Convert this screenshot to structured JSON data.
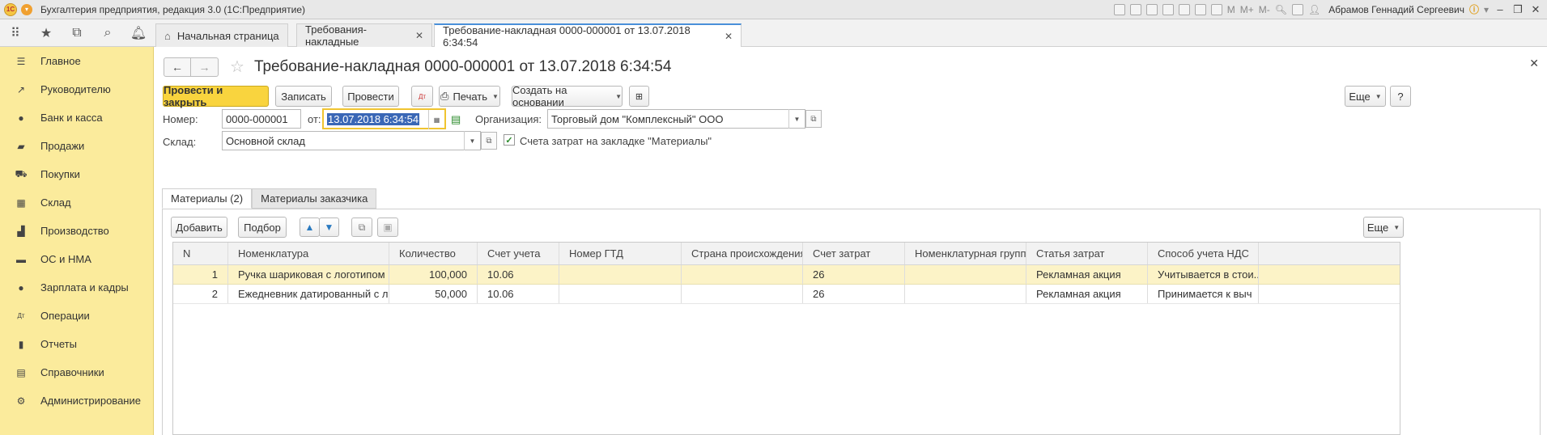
{
  "titlebar": {
    "logo": "1С",
    "app_title": "Бухгалтерия предприятия, редакция 3.0  (1С:Предприятие)",
    "calc_labels": [
      "M",
      "M+",
      "M-"
    ],
    "user": "Абрамов Геннадий Сергеевич"
  },
  "tabs": {
    "home": "Начальная страница",
    "list": "Требования-накладные",
    "doc": "Требование-накладная 0000-000001 от 13.07.2018 6:34:54"
  },
  "sidebar": {
    "items": [
      {
        "label": "Главное",
        "icon": "menu-lines-icon"
      },
      {
        "label": "Руководителю",
        "icon": "trend-icon"
      },
      {
        "label": "Банк и касса",
        "icon": "coin-icon"
      },
      {
        "label": "Продажи",
        "icon": "bag-icon"
      },
      {
        "label": "Покупки",
        "icon": "cart-icon"
      },
      {
        "label": "Склад",
        "icon": "grid-icon"
      },
      {
        "label": "Производство",
        "icon": "factory-icon"
      },
      {
        "label": "ОС и НМА",
        "icon": "truck-icon"
      },
      {
        "label": "Зарплата и кадры",
        "icon": "person-icon"
      },
      {
        "label": "Операции",
        "icon": "dt-kt-icon"
      },
      {
        "label": "Отчеты",
        "icon": "bar-chart-icon"
      },
      {
        "label": "Справочники",
        "icon": "book-icon"
      },
      {
        "label": "Администрирование",
        "icon": "gear-icon"
      }
    ]
  },
  "document": {
    "title": "Требование-накладная 0000-000001 от 13.07.2018 6:34:54",
    "toolbar": {
      "post_close": "Провести и закрыть",
      "save": "Записать",
      "post": "Провести",
      "print": "Печать",
      "create_based": "Создать на основании",
      "more": "Еще",
      "help": "?"
    },
    "fields": {
      "number_label": "Номер:",
      "number_value": "0000-000001",
      "date_label": "от:",
      "date_value": "13.07.2018  6:34:54",
      "org_label": "Организация:",
      "org_value": "Торговый дом \"Комплексный\" ООО",
      "warehouse_label": "Склад:",
      "warehouse_value": "Основной склад",
      "accounts_checkbox": "Счета затрат на закладке \"Материалы\""
    },
    "tabs": {
      "materials": "Материалы (2)",
      "customer_materials": "Материалы заказчика"
    },
    "table_toolbar": {
      "add": "Добавить",
      "pick": "Подбор",
      "more": "Еще"
    },
    "table": {
      "columns": [
        "N",
        "Номенклатура",
        "Количество",
        "Счет учета",
        "Номер ГТД",
        "Страна происхождения",
        "Счет затрат",
        "Номенклатурная группа",
        "Статья затрат",
        "Способ учета НДС"
      ],
      "rows": [
        [
          "1",
          "Ручка шариковая с логотипом",
          "100,000",
          "10.06",
          "",
          "",
          "26",
          "",
          "Рекламная акция",
          "Учитывается в стои..."
        ],
        [
          "2",
          "Ежедневник датированный с лог...",
          "50,000",
          "10.06",
          "",
          "",
          "26",
          "",
          "Рекламная акция",
          "Принимается к выч"
        ]
      ]
    }
  }
}
